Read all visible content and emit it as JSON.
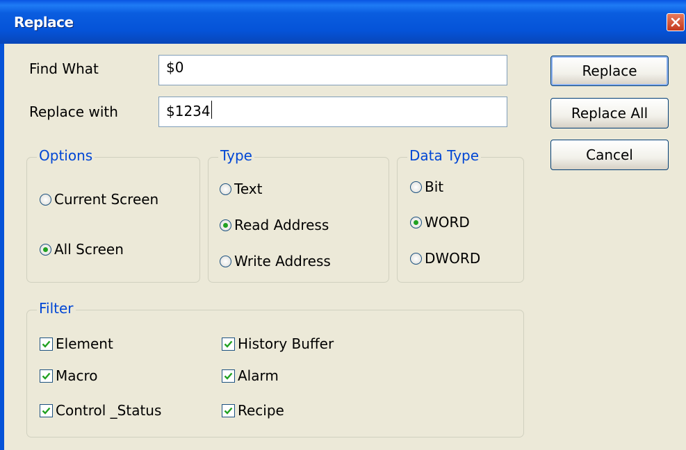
{
  "window": {
    "title": "Replace"
  },
  "find_what": {
    "label": "Find What",
    "value": "$0"
  },
  "replace_with": {
    "label": "Replace with",
    "value": "$1234"
  },
  "buttons": {
    "replace": "Replace",
    "replace_all": "Replace All",
    "cancel": "Cancel"
  },
  "options": {
    "title": "Options",
    "items": [
      {
        "label": "Current Screen",
        "selected": false
      },
      {
        "label": "All Screen",
        "selected": true
      }
    ]
  },
  "type": {
    "title": "Type",
    "items": [
      {
        "label": "Text",
        "selected": false
      },
      {
        "label": "Read Address",
        "selected": true
      },
      {
        "label": "Write Address",
        "selected": false
      }
    ]
  },
  "data_type": {
    "title": "Data Type",
    "items": [
      {
        "label": "Bit",
        "selected": false
      },
      {
        "label": "WORD",
        "selected": true
      },
      {
        "label": "DWORD",
        "selected": false
      }
    ]
  },
  "filter": {
    "title": "Filter",
    "items": [
      {
        "label": "Element",
        "checked": true
      },
      {
        "label": "Macro",
        "checked": true
      },
      {
        "label": "Control _Status",
        "checked": true
      },
      {
        "label": "History Buffer",
        "checked": true
      },
      {
        "label": "Alarm",
        "checked": true
      },
      {
        "label": "Recipe",
        "checked": true
      }
    ]
  },
  "colors": {
    "titlebar": "#0553d8",
    "group_title": "#0046d5",
    "dialog_bg": "#ece9d8",
    "radio_dot": "#21a121",
    "check_mark": "#21a121"
  }
}
